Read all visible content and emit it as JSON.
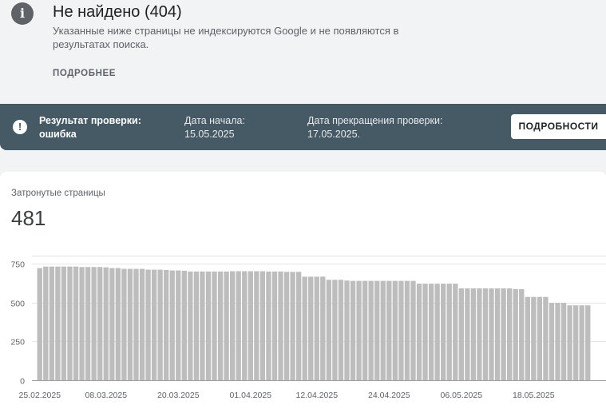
{
  "header": {
    "icon": "info-icon",
    "title": "Не найдено (404)",
    "description": "Указанные ниже страницы не индексируются Google и не появляются в результатах поиска.",
    "more_label": "ПОДРОБНЕЕ"
  },
  "banner": {
    "icon": "alert-icon",
    "status_label": "Результат проверки: ошибка",
    "start_date": "Дата начала: 15.05.2025",
    "stop_date": "Дата прекращения проверки: 17.05.2025.",
    "details_label": "ПОДРОБНОСТИ"
  },
  "metric": {
    "label": "Затронутые страницы",
    "value": "481"
  },
  "chart_data": {
    "type": "bar",
    "ylim": [
      0,
      800
    ],
    "yticks": [
      0,
      250,
      500,
      750
    ],
    "ytick_labels": [
      "0",
      "250",
      "500",
      "750"
    ],
    "xtick_labels": [
      "25.02.2025",
      "08.03.2025",
      "20.03.2025",
      "01.04.2025",
      "12.04.2025",
      "24.04.2025",
      "06.05.2025",
      "18.05.2025"
    ],
    "xtick_index": [
      0,
      11,
      23,
      35,
      46,
      58,
      70,
      82
    ],
    "grid": true,
    "bar_color": "#bdbdbd",
    "values": [
      720,
      730,
      730,
      730,
      730,
      730,
      730,
      727,
      727,
      727,
      727,
      725,
      720,
      720,
      715,
      715,
      715,
      715,
      710,
      710,
      710,
      708,
      705,
      705,
      703,
      698,
      698,
      698,
      698,
      698,
      698,
      698,
      700,
      700,
      700,
      700,
      700,
      700,
      698,
      698,
      698,
      696,
      696,
      696,
      665,
      665,
      665,
      665,
      645,
      645,
      645,
      640,
      638,
      638,
      638,
      638,
      638,
      638,
      638,
      638,
      638,
      638,
      638,
      620,
      620,
      620,
      620,
      620,
      620,
      620,
      590,
      590,
      590,
      590,
      590,
      590,
      590,
      590,
      590,
      585,
      585,
      535,
      535,
      535,
      535,
      497,
      497,
      497,
      481,
      481,
      481,
      481
    ]
  }
}
